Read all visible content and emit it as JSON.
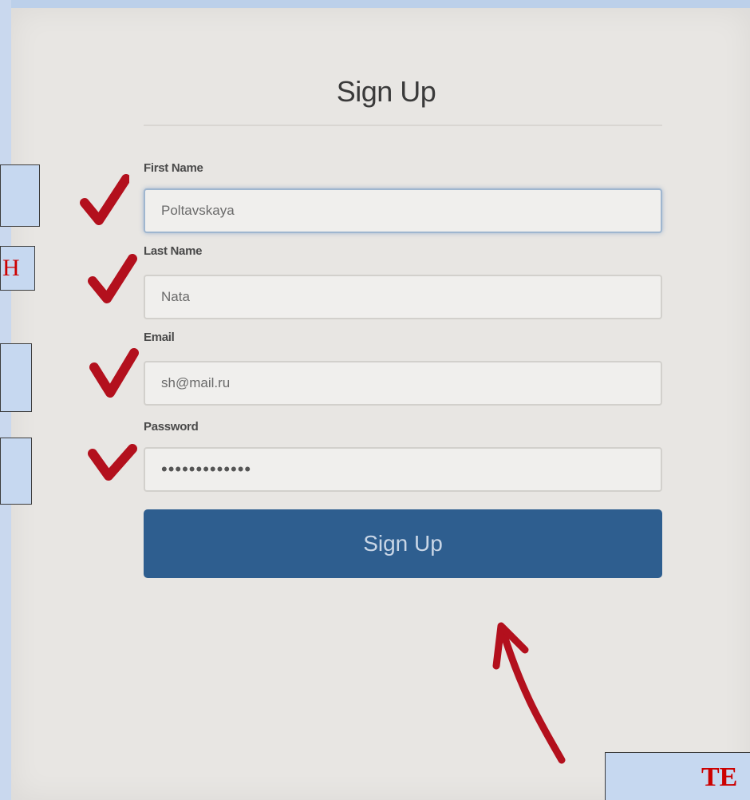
{
  "form": {
    "title": "Sign Up",
    "fields": [
      {
        "label": "First Name",
        "value": "Poltavskaya"
      },
      {
        "label": "Last Name",
        "value": "Nata"
      },
      {
        "label": "Email",
        "value": "sh@mail.ru"
      },
      {
        "label": "Password",
        "value": "•••••••••••••"
      }
    ],
    "submit_label": "Sign Up"
  },
  "side_tags": [
    {
      "text": ""
    },
    {
      "text": "Н"
    },
    {
      "text": ""
    },
    {
      "text": ""
    }
  ],
  "bottom_tag": {
    "text": "ТЕ"
  },
  "colors": {
    "check": "#b3101d",
    "button": "#2e5e8f",
    "tag_text": "#cc0000"
  },
  "icons": {
    "check": "checkmark-icon",
    "arrow": "arrow-up-left-icon"
  }
}
